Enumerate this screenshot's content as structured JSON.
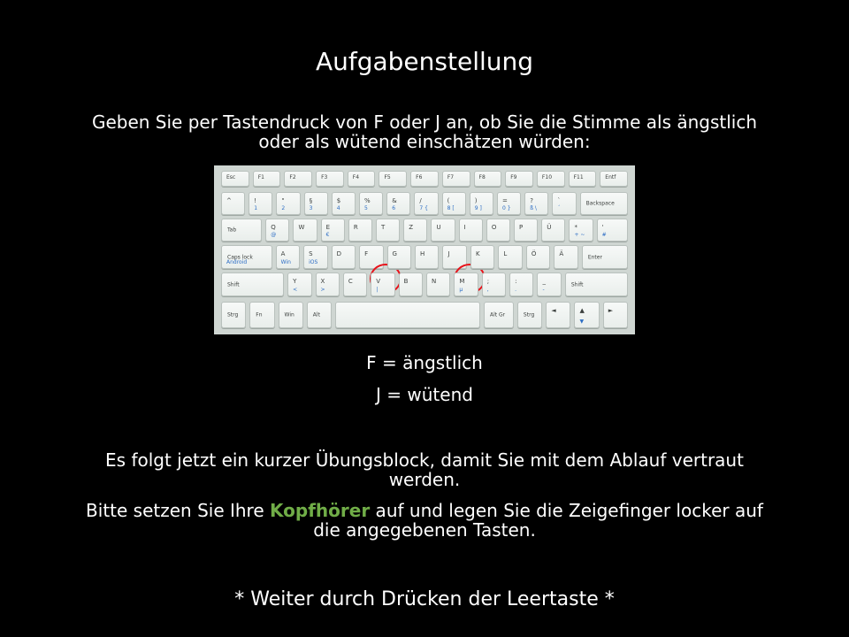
{
  "slide": {
    "title": "Aufgabenstellung",
    "instruction_line1": "Geben Sie per Tastendruck von F oder J an, ob Sie die Stimme als ängstlich",
    "instruction_line2": "oder als wütend einschätzen würden:",
    "key_f": "F = ängstlich",
    "key_j": "J = wütend",
    "info_line1": "Es folgt jetzt ein kurzer Übungsblock, damit Sie mit dem Ablauf vertraut",
    "info_line2": "werden.",
    "headphones_pre": "Bitte setzen Sie Ihre ",
    "headphones_word": "Kopfhörer",
    "headphones_post": " auf und legen Sie die Zeigefinger locker auf",
    "headphones_line2": "die angegebenen Tasten.",
    "continue": "* Weiter durch Drücken der Leertaste *"
  },
  "colors": {
    "background": "#000000",
    "text": "#ffffff",
    "accent": "#70ad47",
    "circle": "#e8121a"
  },
  "keyboard": {
    "highlighted_keys": [
      "F",
      "J"
    ],
    "rows": [
      [
        {
          "main": "Esc",
          "sub": "",
          "alt": ""
        },
        {
          "main": "F1",
          "sub": "",
          "alt": ""
        },
        {
          "main": "F2",
          "sub": "",
          "alt": ""
        },
        {
          "main": "F3",
          "sub": "",
          "alt": ""
        },
        {
          "main": "F4",
          "sub": "",
          "alt": ""
        },
        {
          "main": "F5",
          "sub": "",
          "alt": ""
        },
        {
          "main": "F6",
          "sub": "",
          "alt": ""
        },
        {
          "main": "F7",
          "sub": "",
          "alt": ""
        },
        {
          "main": "F8",
          "sub": "",
          "alt": ""
        },
        {
          "main": "F9",
          "sub": "",
          "alt": ""
        },
        {
          "main": "F10",
          "sub": "",
          "alt": ""
        },
        {
          "main": "F11",
          "sub": "",
          "alt": ""
        },
        {
          "main": "Entf",
          "sub": "",
          "alt": ""
        }
      ],
      [
        {
          "main": "^",
          "sub": "",
          "alt": ""
        },
        {
          "main": "!",
          "sub": "1",
          "alt": ""
        },
        {
          "main": "\"",
          "sub": "2",
          "alt": ""
        },
        {
          "main": "§",
          "sub": "3",
          "alt": ""
        },
        {
          "main": "$",
          "sub": "4",
          "alt": ""
        },
        {
          "main": "%",
          "sub": "5",
          "alt": ""
        },
        {
          "main": "&",
          "sub": "6",
          "alt": ""
        },
        {
          "main": "/",
          "sub": "7 {",
          "alt": ""
        },
        {
          "main": "(",
          "sub": "8 [",
          "alt": ""
        },
        {
          "main": ")",
          "sub": "9 ]",
          "alt": ""
        },
        {
          "main": "=",
          "sub": "0 }",
          "alt": ""
        },
        {
          "main": "?",
          "sub": "ß \\",
          "alt": ""
        },
        {
          "main": "`",
          "sub": "´",
          "alt": ""
        },
        {
          "main": "Backspace",
          "sub": "",
          "alt": ""
        }
      ],
      [
        {
          "main": "Tab",
          "sub": "",
          "alt": ""
        },
        {
          "main": "Q",
          "sub": "@",
          "alt": ""
        },
        {
          "main": "W",
          "sub": "",
          "alt": ""
        },
        {
          "main": "E",
          "sub": "€",
          "alt": ""
        },
        {
          "main": "R",
          "sub": "",
          "alt": ""
        },
        {
          "main": "T",
          "sub": "",
          "alt": ""
        },
        {
          "main": "Z",
          "sub": "",
          "alt": ""
        },
        {
          "main": "U",
          "sub": "",
          "alt": ""
        },
        {
          "main": "I",
          "sub": "",
          "alt": ""
        },
        {
          "main": "O",
          "sub": "",
          "alt": ""
        },
        {
          "main": "P",
          "sub": "",
          "alt": ""
        },
        {
          "main": "Ü",
          "sub": "",
          "alt": ""
        },
        {
          "main": "*",
          "sub": "+ ~",
          "alt": ""
        },
        {
          "main": "'",
          "sub": "#",
          "alt": ""
        }
      ],
      [
        {
          "main": "Caps lock",
          "sub": "Android",
          "alt": ""
        },
        {
          "main": "A",
          "sub": "Win",
          "alt": ""
        },
        {
          "main": "S",
          "sub": "iOS",
          "alt": ""
        },
        {
          "main": "D",
          "sub": "",
          "alt": ""
        },
        {
          "main": "F",
          "sub": "",
          "alt": ""
        },
        {
          "main": "G",
          "sub": "",
          "alt": ""
        },
        {
          "main": "H",
          "sub": "",
          "alt": ""
        },
        {
          "main": "J",
          "sub": "",
          "alt": ""
        },
        {
          "main": "K",
          "sub": "",
          "alt": ""
        },
        {
          "main": "L",
          "sub": "",
          "alt": ""
        },
        {
          "main": "Ö",
          "sub": "",
          "alt": ""
        },
        {
          "main": "Ä",
          "sub": "",
          "alt": ""
        },
        {
          "main": "Enter",
          "sub": "",
          "alt": ""
        }
      ],
      [
        {
          "main": "Shift",
          "sub": "",
          "alt": ""
        },
        {
          "main": "Y",
          "sub": "<",
          "alt": ""
        },
        {
          "main": "X",
          "sub": ">",
          "alt": ""
        },
        {
          "main": "C",
          "sub": "",
          "alt": ""
        },
        {
          "main": "V",
          "sub": "|",
          "alt": ""
        },
        {
          "main": "B",
          "sub": "",
          "alt": ""
        },
        {
          "main": "N",
          "sub": "",
          "alt": ""
        },
        {
          "main": "M",
          "sub": "µ",
          "alt": ""
        },
        {
          "main": ";",
          "sub": ",",
          "alt": ""
        },
        {
          "main": ":",
          "sub": ".",
          "alt": ""
        },
        {
          "main": "_",
          "sub": "-",
          "alt": ""
        },
        {
          "main": "Shift",
          "sub": "",
          "alt": ""
        }
      ],
      [
        {
          "main": "Strg",
          "sub": "",
          "alt": ""
        },
        {
          "main": "Fn",
          "sub": "",
          "alt": ""
        },
        {
          "main": "Win",
          "sub": "",
          "alt": ""
        },
        {
          "main": "Alt",
          "sub": "",
          "alt": ""
        },
        {
          "main": "",
          "sub": "",
          "alt": ""
        },
        {
          "main": "Alt Gr",
          "sub": "",
          "alt": ""
        },
        {
          "main": "Strg",
          "sub": "",
          "alt": ""
        },
        {
          "main": "◄",
          "sub": "",
          "alt": ""
        },
        {
          "main": "▲",
          "sub": "▼",
          "alt": ""
        },
        {
          "main": "►",
          "sub": "",
          "alt": ""
        }
      ]
    ]
  }
}
